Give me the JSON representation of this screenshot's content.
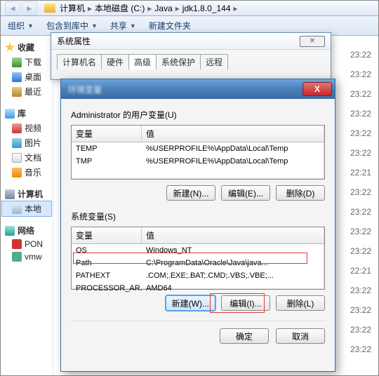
{
  "explorer": {
    "breadcrumb": [
      "计算机",
      "本地磁盘 (C:)",
      "Java",
      "jdk1.8.0_144"
    ],
    "toolbar": {
      "organize": "组织",
      "include": "包含到库中",
      "share": "共享",
      "newfolder": "新建文件夹"
    }
  },
  "sidebar": {
    "favorites": {
      "head": "收藏",
      "items": [
        "下载",
        "桌面",
        "最近"
      ]
    },
    "libraries": {
      "head": "库",
      "items": [
        "视频",
        "图片",
        "文档",
        "音乐"
      ]
    },
    "computer": {
      "head": "计算机",
      "items": [
        "本地"
      ]
    },
    "network": {
      "head": "网络",
      "items": [
        "PON",
        "vmw"
      ]
    }
  },
  "filetimes": [
    "23:22",
    "23:22",
    "23:22",
    "23:22",
    "23:22",
    "23:22",
    "22:21",
    "23:22",
    "23:22",
    "23:22",
    "23:22",
    "22:21",
    "23:22",
    "23:22",
    "23:22",
    "23:22"
  ],
  "sysprops": {
    "title": "系统属性",
    "tabs": [
      "计算机名",
      "硬件",
      "高级",
      "系统保护",
      "远程"
    ],
    "active_tab": "高级"
  },
  "env": {
    "title": "环境变量",
    "user_label": "Administrator 的用户变量(U)",
    "sys_label": "系统变量(S)",
    "col_var": "变量",
    "col_val": "值",
    "user_vars": [
      {
        "name": "TEMP",
        "value": "%USERPROFILE%\\AppData\\Local\\Temp"
      },
      {
        "name": "TMP",
        "value": "%USERPROFILE%\\AppData\\Local\\Temp"
      }
    ],
    "sys_vars": [
      {
        "name": "OS",
        "value": "Windows_NT"
      },
      {
        "name": "Path",
        "value": "C:\\ProgramData\\Oracle\\Java\\java..."
      },
      {
        "name": "PATHEXT",
        "value": ".COM;.EXE;.BAT;.CMD;.VBS;.VBE;..."
      },
      {
        "name": "PROCESSOR_AR...",
        "value": "AMD64"
      }
    ],
    "buttons": {
      "new_u": "新建(N)...",
      "edit_u": "编辑(E)...",
      "del_u": "删除(D)",
      "new_s": "新建(W)...",
      "edit_s": "编辑(I)...",
      "del_s": "删除(L)",
      "ok": "确定",
      "cancel": "取消"
    }
  }
}
